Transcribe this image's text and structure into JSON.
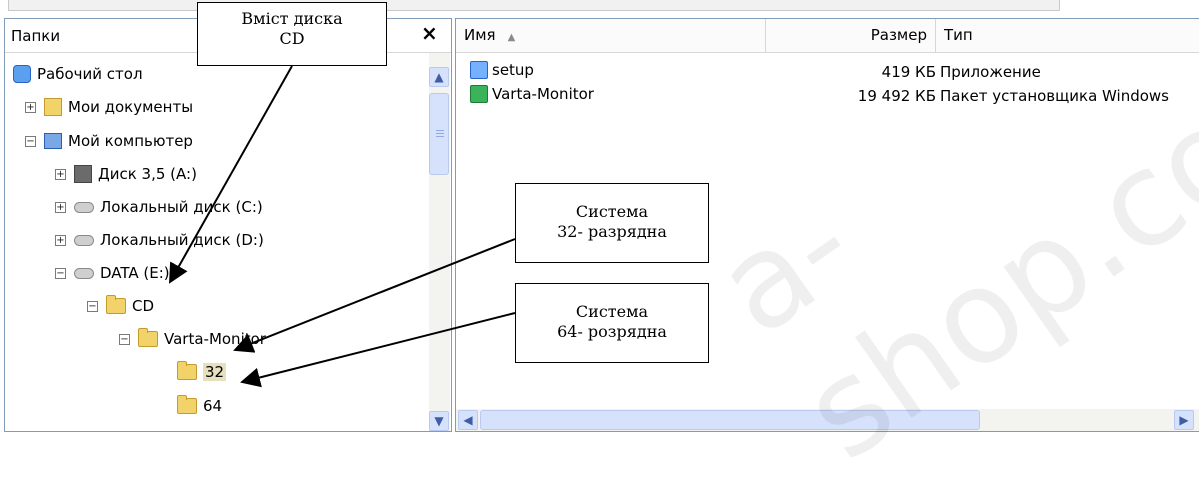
{
  "left_pane": {
    "title": "Папки",
    "close": "×",
    "tree": [
      {
        "label": "Рабочий стол",
        "icon": "desktop-icon"
      },
      {
        "label": "Мои документы",
        "icon": "documents-icon",
        "toggle": "+"
      },
      {
        "label": "Мой компьютер",
        "icon": "computer-icon",
        "toggle": "−"
      },
      {
        "label": "Диск 3,5 (A:)",
        "icon": "floppy-icon",
        "toggle": "+"
      },
      {
        "label": "Локальный диск (C:)",
        "icon": "drive-icon",
        "toggle": "+"
      },
      {
        "label": "Локальный диск (D:)",
        "icon": "drive-icon",
        "toggle": "+"
      },
      {
        "label": "DATA (E:)",
        "icon": "drive-icon",
        "toggle": "−"
      },
      {
        "label": "CD",
        "icon": "folder-icon",
        "toggle": "−"
      },
      {
        "label": "Varta-Monitor",
        "icon": "folder-icon",
        "toggle": "−"
      },
      {
        "label": "32",
        "icon": "folder-icon"
      },
      {
        "label": "64",
        "icon": "folder-icon"
      }
    ]
  },
  "right_pane": {
    "columns": {
      "name": "Имя",
      "size": "Размер",
      "type": "Тип"
    },
    "files": [
      {
        "name": "setup",
        "size": "419 КБ",
        "type": "Приложение",
        "icon": "setup-icon"
      },
      {
        "name": "Varta-Monitor",
        "size": "19 492 КБ",
        "type": "Пакет установщика Windows",
        "icon": "installer-icon"
      }
    ]
  },
  "callouts": {
    "cd": [
      "Вміст диска",
      "CD"
    ],
    "sys32": [
      "Система",
      "32- разрядна"
    ],
    "sys64": [
      "Система",
      "64- розрядна"
    ]
  },
  "watermark": "a-shop.co",
  "colors": {
    "border": "#7f9db9",
    "scroll": "#d6e2fb",
    "selection": "#e7e0bf"
  }
}
